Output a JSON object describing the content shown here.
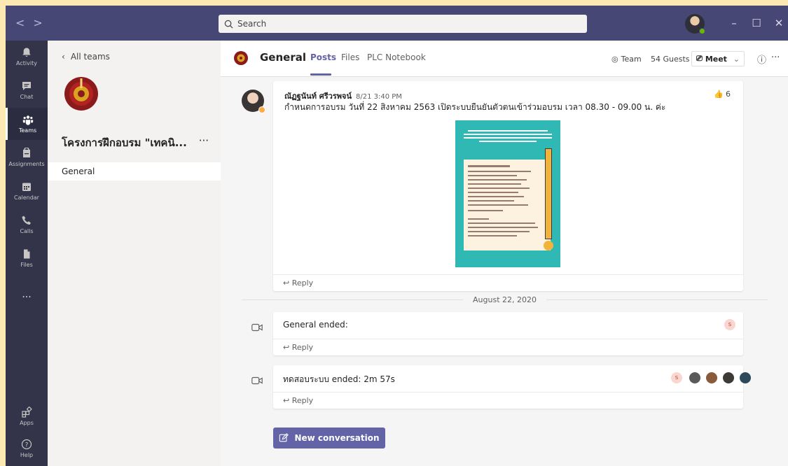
{
  "titlebar": {
    "search_placeholder": "Search",
    "nav_back": "<",
    "nav_forward": ">"
  },
  "rail": {
    "items": [
      {
        "label": "Activity",
        "icon": "bell-icon"
      },
      {
        "label": "Chat",
        "icon": "chat-icon"
      },
      {
        "label": "Teams",
        "icon": "teams-icon",
        "active": true
      },
      {
        "label": "Assignments",
        "icon": "assignments-icon"
      },
      {
        "label": "Calendar",
        "icon": "calendar-icon"
      },
      {
        "label": "Calls",
        "icon": "phone-icon"
      },
      {
        "label": "Files",
        "icon": "file-icon"
      },
      {
        "label": "...",
        "icon": "more-icon"
      }
    ],
    "bottom": [
      {
        "label": "Apps",
        "icon": "apps-icon"
      },
      {
        "label": "Help",
        "icon": "help-icon"
      }
    ]
  },
  "teampanel": {
    "back_label": "All teams",
    "team_name": "โครงการฝึกอบรม \"เทคนิ...",
    "more": "···",
    "channels": [
      {
        "label": "General"
      }
    ]
  },
  "header": {
    "channel": "General",
    "tabs": [
      "Posts",
      "Files",
      "PLC Notebook"
    ],
    "team_btn": "Team",
    "guests_btn": "54 Guests",
    "meet_btn": "Meet",
    "info": "ⓘ",
    "more": "···"
  },
  "post": {
    "author": "ณัฏฐนันท์ ศรีวรพจน์",
    "time": "8/21 3:40 PM",
    "message": "กำหนดการอบรม วันที่ 22 สิงหาคม 2563 เปิดระบบยืนยันตัวตนเข้าร่วมอบรม เวลา 08.30 - 09.00 น. ค่ะ",
    "likes": "6",
    "reply": "Reply"
  },
  "date_separator": "August 22, 2020",
  "meetings": [
    {
      "title": "General ended:",
      "reply": "Reply",
      "avatar_initial": "S"
    },
    {
      "title": "ทดสอบระบบ ended: 2m 57s",
      "reply": "Reply",
      "avatar_initial": "S"
    }
  ],
  "new_conversation": "New conversation",
  "colors": {
    "accent": "#6264a7",
    "titlebar": "#464775",
    "rail": "#33344a",
    "frame": "#fce8b2"
  }
}
